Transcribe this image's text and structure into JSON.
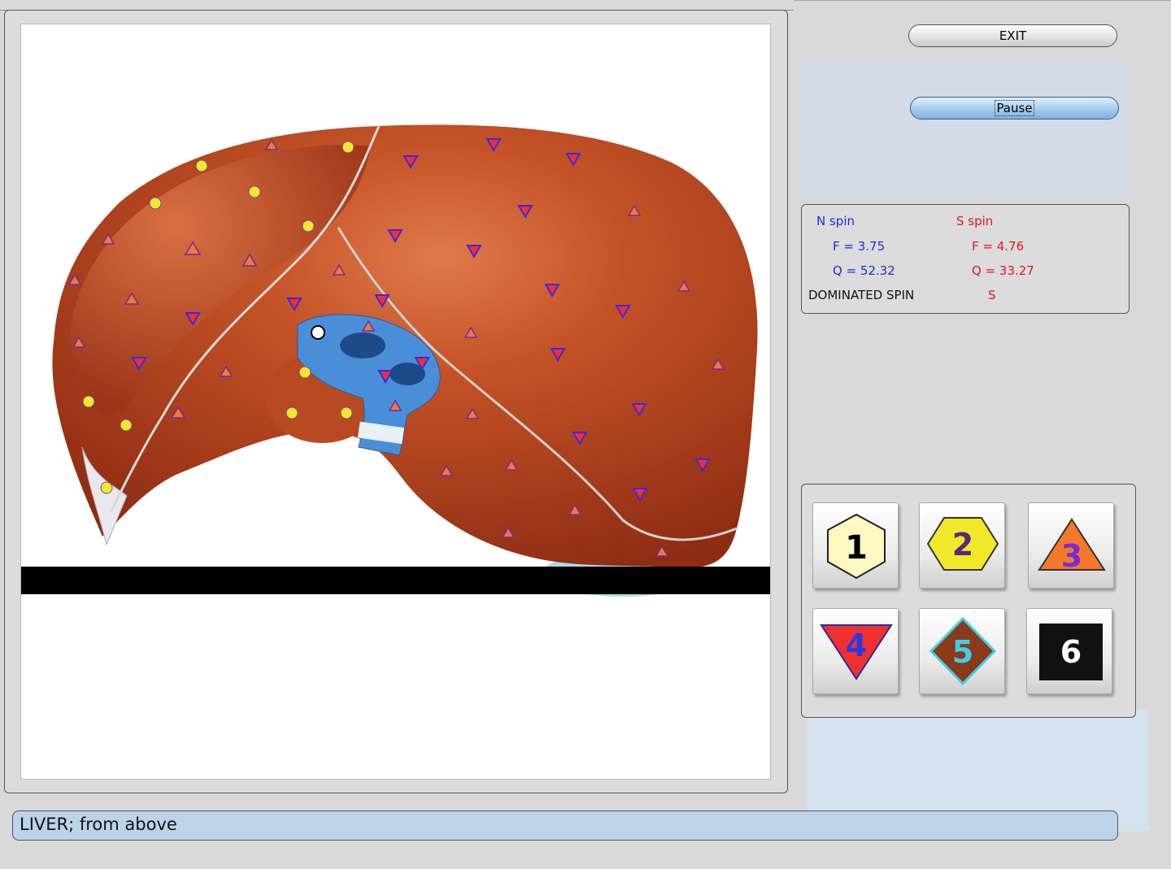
{
  "buttons": {
    "exit_label": "EXIT",
    "pause_label": "Pause"
  },
  "spin": {
    "n_title": "N spin",
    "n_f": "F =  3.75",
    "n_q": "Q = 52.32",
    "s_title": "S spin",
    "s_f": "F =  4.76",
    "s_q": "Q = 33.27",
    "dominated_label": "DOMINATED SPIN",
    "dominated_value": "S"
  },
  "symbols": [
    {
      "label": "1",
      "shape": "hexagon-vertical",
      "fill": "#fdf8c0",
      "text_color": "#000000"
    },
    {
      "label": "2",
      "shape": "hexagon-horizontal",
      "fill": "#f2e82a",
      "text_color": "#5a2a7a"
    },
    {
      "label": "3",
      "shape": "triangle-up",
      "fill": "#f47a2a",
      "text_color": "#7a2ad8"
    },
    {
      "label": "4",
      "shape": "triangle-down",
      "fill": "#f03030",
      "text_color": "#2a3ae0"
    },
    {
      "label": "5",
      "shape": "diamond",
      "fill": "#8a3a1a",
      "text_color": "#3ad0e8"
    },
    {
      "label": "6",
      "shape": "square",
      "fill": "#111111",
      "text_color": "#ffffff"
    }
  ],
  "status": {
    "text": "LIVER;  from above"
  },
  "colors": {
    "liver": "#b5401c",
    "vessel": "#4a8ed8",
    "panel": "#d9d9d9",
    "status_bg": "#bcd3e9"
  }
}
